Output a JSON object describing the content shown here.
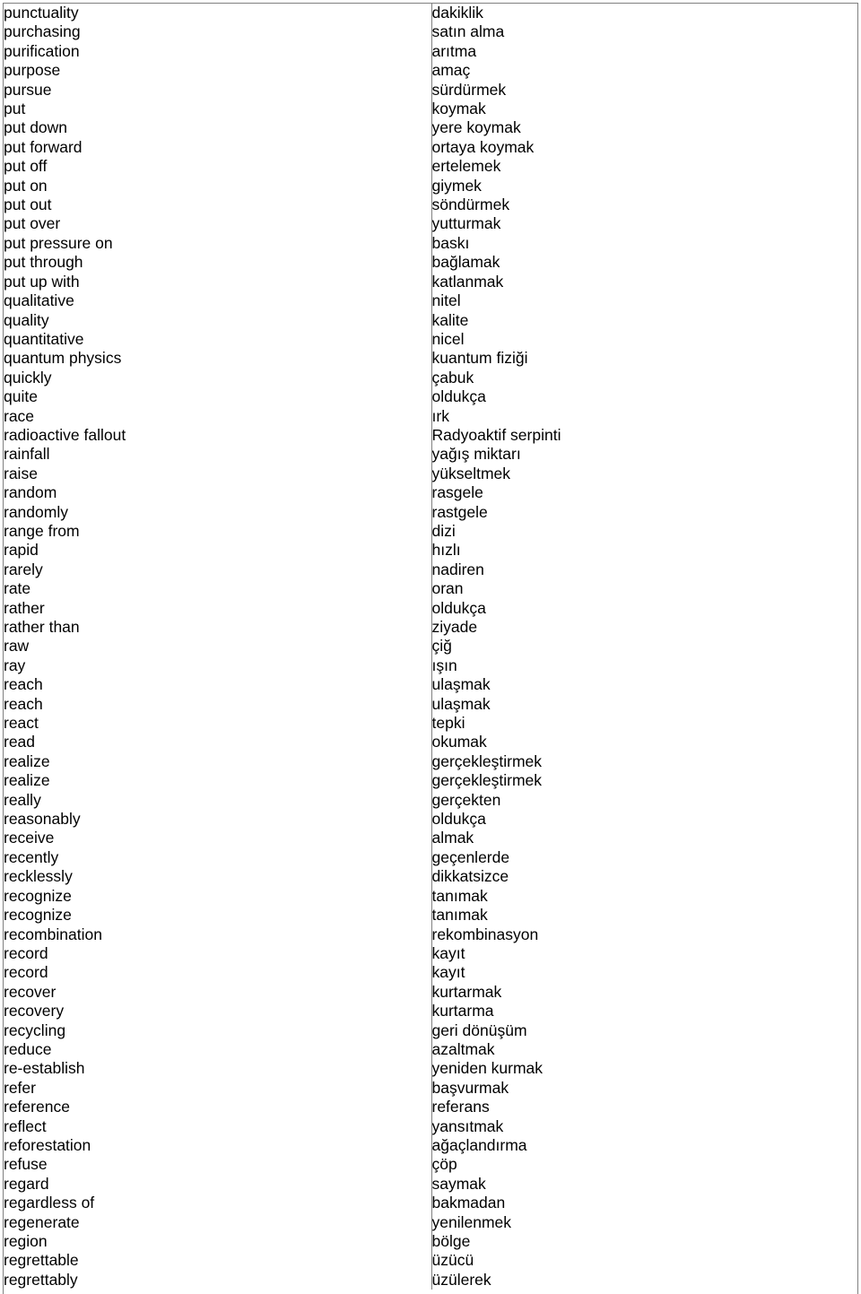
{
  "document": {
    "type": "bilingual-glossary",
    "source_language": "English",
    "target_language": "Turkish",
    "columns": 2,
    "row_count": 66,
    "border_color": "#808080",
    "text_color": "#000000",
    "background_color": "#ffffff"
  },
  "entries": [
    {
      "source": "punctuality",
      "target": "dakiklik"
    },
    {
      "source": "purchasing",
      "target": "satın alma"
    },
    {
      "source": "purification",
      "target": "arıtma"
    },
    {
      "source": "purpose",
      "target": "amaç"
    },
    {
      "source": "pursue",
      "target": "sürdürmek"
    },
    {
      "source": "put",
      "target": "koymak"
    },
    {
      "source": "put down",
      "target": "yere koymak"
    },
    {
      "source": "put forward",
      "target": "ortaya koymak"
    },
    {
      "source": "put off",
      "target": "ertelemek"
    },
    {
      "source": "put on",
      "target": "giymek"
    },
    {
      "source": "put out",
      "target": "söndürmek"
    },
    {
      "source": "put over",
      "target": "yutturmak"
    },
    {
      "source": "put pressure on",
      "target": "baskı"
    },
    {
      "source": "put through",
      "target": "bağlamak"
    },
    {
      "source": "put up with",
      "target": "katlanmak"
    },
    {
      "source": "qualitative",
      "target": "nitel"
    },
    {
      "source": "quality",
      "target": "kalite"
    },
    {
      "source": "quantitative",
      "target": "nicel"
    },
    {
      "source": "quantum physics",
      "target": "kuantum fiziği"
    },
    {
      "source": "quickly",
      "target": "çabuk"
    },
    {
      "source": "quite",
      "target": "oldukça"
    },
    {
      "source": "race",
      "target": "ırk"
    },
    {
      "source": "radioactive fallout",
      "target": "Radyoaktif serpinti"
    },
    {
      "source": "rainfall",
      "target": "yağış miktarı"
    },
    {
      "source": "raise",
      "target": "yükseltmek"
    },
    {
      "source": "random",
      "target": "rasgele"
    },
    {
      "source": "randomly",
      "target": "rastgele"
    },
    {
      "source": "range from",
      "target": "dizi"
    },
    {
      "source": "rapid",
      "target": "hızlı"
    },
    {
      "source": "rarely",
      "target": "nadiren"
    },
    {
      "source": "rate",
      "target": "oran"
    },
    {
      "source": "rather",
      "target": "oldukça"
    },
    {
      "source": "rather than",
      "target": "ziyade"
    },
    {
      "source": "raw",
      "target": "çiğ"
    },
    {
      "source": "ray",
      "target": "ışın"
    },
    {
      "source": "reach",
      "target": "ulaşmak"
    },
    {
      "source": "reach",
      "target": "ulaşmak"
    },
    {
      "source": "react",
      "target": "tepki"
    },
    {
      "source": "read",
      "target": "okumak"
    },
    {
      "source": "realize",
      "target": "gerçekleştirmek"
    },
    {
      "source": "realize",
      "target": "gerçekleştirmek"
    },
    {
      "source": "really",
      "target": "gerçekten"
    },
    {
      "source": "reasonably",
      "target": "oldukça"
    },
    {
      "source": "receive",
      "target": "almak"
    },
    {
      "source": "recently",
      "target": "geçenlerde"
    },
    {
      "source": "recklessly",
      "target": "dikkatsizce"
    },
    {
      "source": "recognize",
      "target": "tanımak"
    },
    {
      "source": "recognize",
      "target": "tanımak"
    },
    {
      "source": "recombination",
      "target": "rekombinasyon"
    },
    {
      "source": "record",
      "target": "kayıt"
    },
    {
      "source": "record",
      "target": "kayıt"
    },
    {
      "source": "recover",
      "target": "kurtarmak"
    },
    {
      "source": "recovery",
      "target": "kurtarma"
    },
    {
      "source": "recycling",
      "target": "geri dönüşüm"
    },
    {
      "source": "reduce",
      "target": "azaltmak"
    },
    {
      "source": "re-establish",
      "target": "yeniden kurmak"
    },
    {
      "source": "refer",
      "target": "başvurmak"
    },
    {
      "source": "reference",
      "target": "referans"
    },
    {
      "source": "reflect",
      "target": "yansıtmak"
    },
    {
      "source": "reforestation",
      "target": "ağaçlandırma"
    },
    {
      "source": "refuse",
      "target": "çöp"
    },
    {
      "source": "regard",
      "target": "saymak"
    },
    {
      "source": "regardless of",
      "target": "bakmadan"
    },
    {
      "source": "regenerate",
      "target": "yenilenmek"
    },
    {
      "source": "region",
      "target": "bölge"
    },
    {
      "source": "regrettable",
      "target": "üzücü"
    },
    {
      "source": "regrettably",
      "target": "üzülerek"
    }
  ]
}
